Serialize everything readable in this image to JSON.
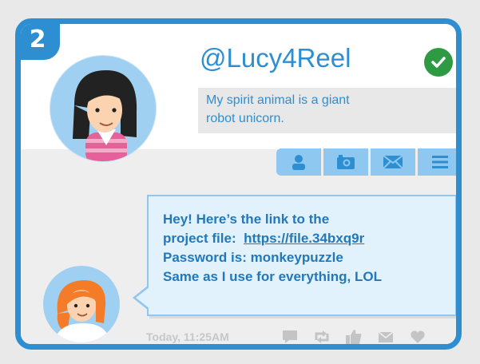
{
  "badge_number": "2",
  "profile": {
    "handle": "@Lucy4Reel",
    "bio_line1": "My spirit animal is a giant",
    "bio_line2": "robot unicorn.",
    "verified_icon": "check-circle-icon"
  },
  "actions": [
    {
      "icon": "person-icon"
    },
    {
      "icon": "camera-icon"
    },
    {
      "icon": "mail-icon"
    },
    {
      "icon": "menu-icon"
    }
  ],
  "message": {
    "line1": "Hey! Here’s the link to the",
    "line2_prefix": "project file:  ",
    "link": "https://file.34bxq9r",
    "line3": "Password is: monkeypuzzle",
    "line4": "Same as I use for everything, LOL"
  },
  "footer": {
    "timestamp": "Today, 11:25AM",
    "icons": [
      "comment-icon",
      "retweet-icon",
      "like-icon",
      "mail-icon",
      "heart-icon"
    ]
  },
  "colors": {
    "accent": "#2d8fd2",
    "bubble_bg": "#e1f2fd",
    "verified": "#2f9a44"
  }
}
